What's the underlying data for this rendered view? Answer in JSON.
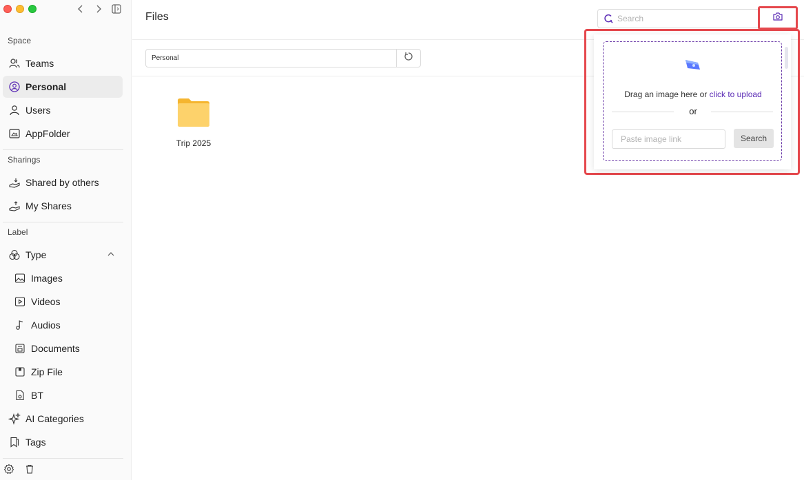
{
  "sidebar": {
    "sections": {
      "space": "Space",
      "sharings": "Sharings",
      "label": "Label"
    },
    "space_items": [
      {
        "label": "Teams"
      },
      {
        "label": "Personal"
      },
      {
        "label": "Users"
      },
      {
        "label": "AppFolder"
      }
    ],
    "sharing_items": [
      {
        "label": "Shared by others"
      },
      {
        "label": "My Shares"
      }
    ],
    "label_items": [
      {
        "label": "Type"
      },
      {
        "label": "Images"
      },
      {
        "label": "Videos"
      },
      {
        "label": "Audios"
      },
      {
        "label": "Documents"
      },
      {
        "label": "Zip File"
      },
      {
        "label": "BT"
      },
      {
        "label": "AI Categories"
      },
      {
        "label": "Tags"
      }
    ]
  },
  "header": {
    "title": "Files",
    "search_placeholder": "Search"
  },
  "path_bar": {
    "value": "Personal"
  },
  "files": [
    {
      "name": "Trip 2025",
      "type": "folder"
    }
  ],
  "image_search_popover": {
    "drag_text": "Drag an image here or ",
    "upload_link": "click to upload",
    "or_text": "or",
    "link_placeholder": "Paste image link",
    "search_button": "Search"
  },
  "colors": {
    "accent": "#5b2bb5",
    "highlight": "#e5484d",
    "folder": "#fbc94b"
  }
}
